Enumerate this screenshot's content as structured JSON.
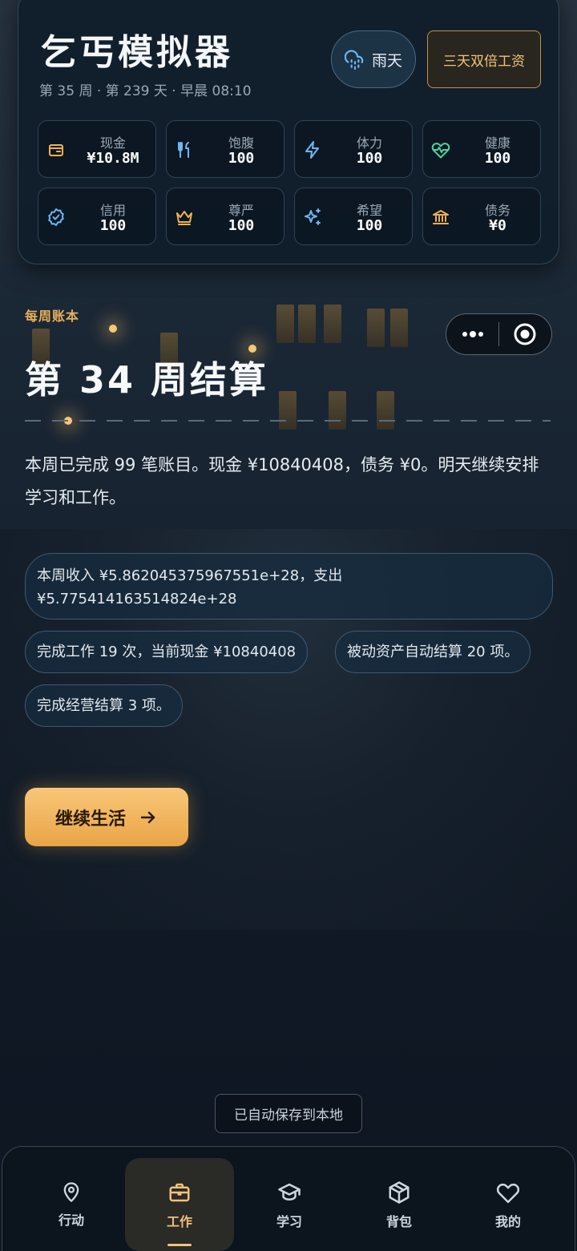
{
  "header": {
    "title": "乞丐模拟器",
    "subtitle": "第 35 周 · 第 239 天 · 早晨 08:10",
    "weather": {
      "label": "雨天",
      "icon": "cloud-rain-icon"
    },
    "bonus": "三天双倍工资"
  },
  "stats": [
    {
      "key": "cash",
      "label": "现金",
      "value": "¥10.8M",
      "icon": "wallet-icon",
      "color": "#f2b14f"
    },
    {
      "key": "satiety",
      "label": "饱腹",
      "value": "100",
      "icon": "utensils-icon",
      "color": "#6fb6f0"
    },
    {
      "key": "stamina",
      "label": "体力",
      "value": "100",
      "icon": "lightning-icon",
      "color": "#6fb6f0"
    },
    {
      "key": "health",
      "label": "健康",
      "value": "100",
      "icon": "heart-pulse-icon",
      "color": "#4fd49a"
    },
    {
      "key": "credit",
      "label": "信用",
      "value": "100",
      "icon": "badge-check-icon",
      "color": "#6fb6f0"
    },
    {
      "key": "dignity",
      "label": "尊严",
      "value": "100",
      "icon": "crown-icon",
      "color": "#f2b14f"
    },
    {
      "key": "hope",
      "label": "希望",
      "value": "100",
      "icon": "sparkles-icon",
      "color": "#6fb6f0"
    },
    {
      "key": "debt",
      "label": "债务",
      "value": "¥0",
      "icon": "bank-icon",
      "color": "#f2b14f"
    }
  ],
  "main": {
    "tag": "每周账本",
    "title": "第 34 周结算",
    "summary": "本周已完成 99 笔账目。现金 ¥10840408，债务 ¥0。明天继续安排学习和工作。",
    "chips": [
      "本周收入 ¥5.862045375967551e+28，支出 ¥5.775414163514824e+28",
      "完成工作 19 次，当前现金 ¥10840408",
      "被动资产自动结算 20 项。",
      "完成经营结算 3 项。"
    ],
    "continue_label": "继续生活"
  },
  "autosave": "已自动保存到本地",
  "nav": {
    "active": "工作",
    "items": [
      {
        "label": "行动",
        "icon": "map-pin-icon"
      },
      {
        "label": "工作",
        "icon": "briefcase-icon"
      },
      {
        "label": "学习",
        "icon": "graduation-cap-icon"
      },
      {
        "label": "背包",
        "icon": "box-icon"
      },
      {
        "label": "我的",
        "icon": "heart-icon"
      }
    ]
  },
  "colors": {
    "accent": "#f2c27a",
    "button_gradient_start": "#f8c778",
    "button_gradient_end": "#e9a446",
    "card_bg": "#101e2c"
  }
}
